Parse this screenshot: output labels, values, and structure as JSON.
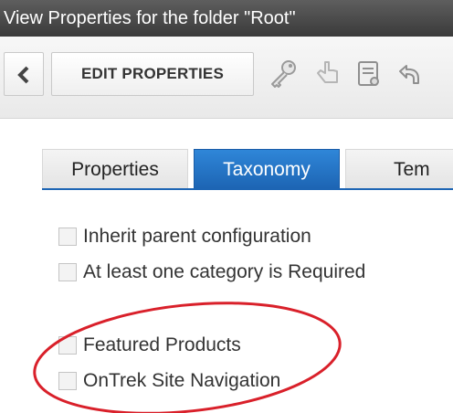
{
  "window": {
    "title": "View Properties for the folder \"Root\""
  },
  "toolbar": {
    "back_icon": "chevron-left-icon",
    "edit_label": "EDIT PROPERTIES",
    "icons": [
      "key-icon",
      "hand-icon",
      "document-icon",
      "undo-icon"
    ]
  },
  "tabs": [
    {
      "label": "Properties",
      "active": false
    },
    {
      "label": "Taxonomy",
      "active": true
    },
    {
      "label": "Tem",
      "active": false
    }
  ],
  "options": [
    {
      "label": "Inherit parent configuration",
      "checked": false
    },
    {
      "label": "At least one category is Required",
      "checked": false
    },
    {
      "label": "Featured Products",
      "checked": false
    },
    {
      "label": "OnTrek Site Navigation",
      "checked": false
    }
  ],
  "colors": {
    "active_tab": "#1d65b4",
    "highlight_oval": "#d9202a",
    "title_bar": "#4a4a4a"
  }
}
